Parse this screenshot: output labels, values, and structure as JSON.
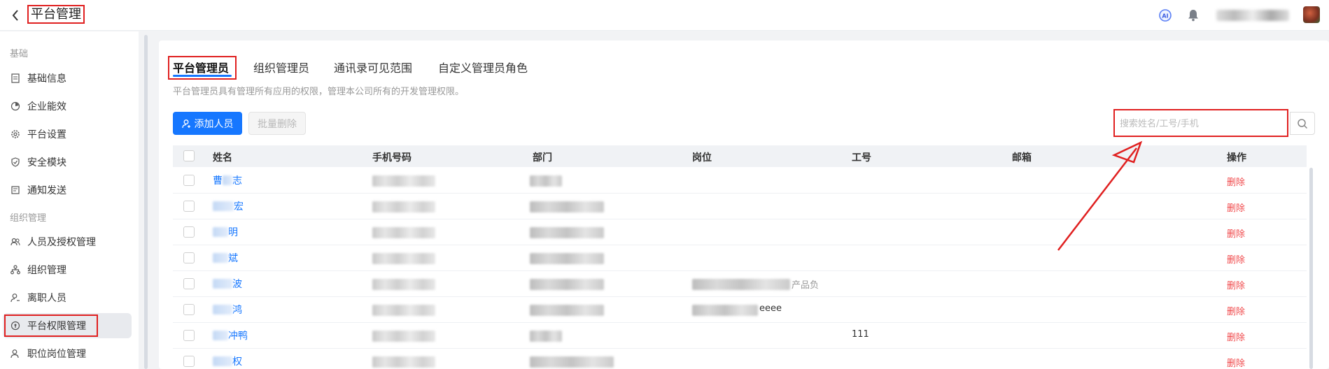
{
  "header": {
    "title": "平台管理",
    "back_icon": "chevron-left-icon",
    "ai_icon": "ai-assistant-icon",
    "bell_icon": "bell-icon"
  },
  "sidebar": {
    "sections": [
      {
        "label": "基础",
        "items": [
          {
            "label": "基础信息",
            "icon": "document-icon"
          },
          {
            "label": "企业能效",
            "icon": "efficiency-icon"
          },
          {
            "label": "平台设置",
            "icon": "gear-icon"
          },
          {
            "label": "安全模块",
            "icon": "shield-check-icon"
          },
          {
            "label": "通知发送",
            "icon": "notification-icon"
          }
        ]
      },
      {
        "label": "组织管理",
        "items": [
          {
            "label": "人员及授权管理",
            "icon": "users-icon"
          },
          {
            "label": "组织管理",
            "icon": "org-tree-icon"
          },
          {
            "label": "离职人员",
            "icon": "user-leave-icon"
          },
          {
            "label": "平台权限管理",
            "icon": "permission-shield-icon",
            "active": true
          },
          {
            "label": "职位岗位管理",
            "icon": "position-icon"
          }
        ]
      }
    ]
  },
  "tabs": [
    {
      "label": "平台管理员",
      "active": true
    },
    {
      "label": "组织管理员"
    },
    {
      "label": "通讯录可见范围"
    },
    {
      "label": "自定义管理员角色"
    }
  ],
  "description": "平台管理员具有管理所有应用的权限，管理本公司所有的开发管理权限。",
  "toolbar": {
    "add_label": "添加人员",
    "batch_delete_label": "批量删除"
  },
  "search": {
    "placeholder": "搜索姓名/工号/手机"
  },
  "table": {
    "columns": [
      "姓名",
      "手机号码",
      "部门",
      "岗位",
      "工号",
      "邮箱",
      "操作"
    ],
    "rows": [
      {
        "name": "曹",
        "name_suffix": "志",
        "position": "",
        "employee_id": "",
        "email": "",
        "action": "删除"
      },
      {
        "name": "",
        "name_suffix": "宏",
        "position": "",
        "employee_id": "",
        "email": "",
        "action": "删除"
      },
      {
        "name": "",
        "name_suffix": "明",
        "position": "",
        "employee_id": "",
        "email": "",
        "action": "删除"
      },
      {
        "name": "",
        "name_suffix": "斌",
        "position": "",
        "employee_id": "",
        "email": "",
        "action": "删除"
      },
      {
        "name": "",
        "name_suffix": "波",
        "position": "产品负",
        "employee_id": "",
        "email": "",
        "action": "删除"
      },
      {
        "name": "",
        "name_suffix": "鸿",
        "position": "eeee",
        "employee_id": "",
        "email": "",
        "action": "删除"
      },
      {
        "name": "",
        "name_suffix": "冲鸭",
        "position": "",
        "employee_id": "111",
        "email": "",
        "action": "删除"
      },
      {
        "name": "",
        "name_suffix": "权",
        "position": "",
        "employee_id": "",
        "email": "",
        "action": "删除"
      }
    ]
  },
  "colors": {
    "accent": "#1677ff",
    "danger": "#f0494b",
    "annotation": "#e02020"
  }
}
